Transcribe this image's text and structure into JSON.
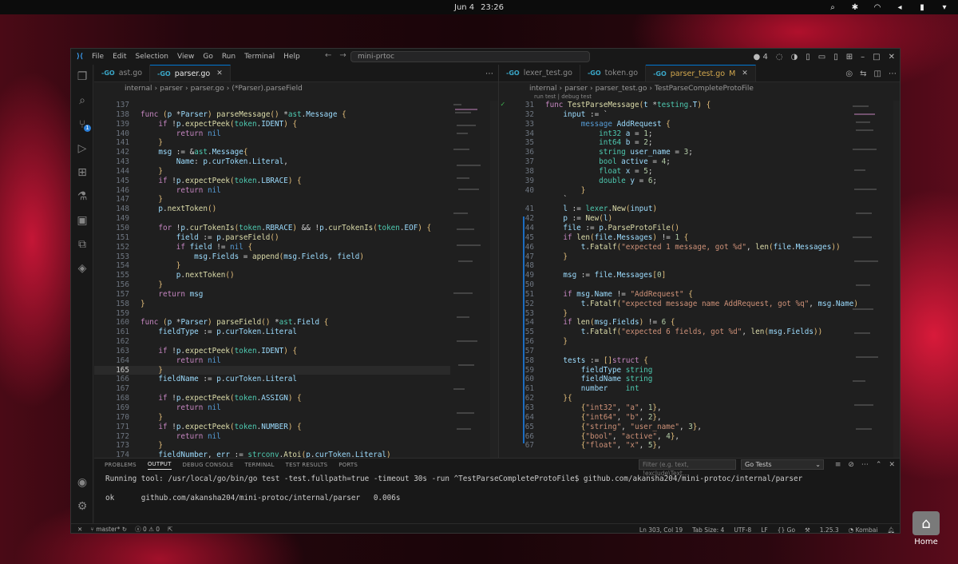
{
  "topbar": {
    "date": "Jun 4",
    "time": "23:26"
  },
  "desktop": {
    "home_label": "Home"
  },
  "menu": [
    "File",
    "Edit",
    "Selection",
    "View",
    "Go",
    "Run",
    "Terminal",
    "Help"
  ],
  "search_text": "mini-prtoc",
  "title_right": {
    "ports": "4"
  },
  "left": {
    "tabs": [
      {
        "label": "ast.go",
        "active": false
      },
      {
        "label": "parser.go",
        "active": true
      }
    ],
    "crumb": [
      "internal",
      "parser",
      "parser.go",
      "(*Parser).parseField"
    ],
    "code": [
      {
        "n": "137",
        "t": ""
      },
      {
        "n": "138",
        "t": "func (p *Parser) parseMessage() *ast.Message {"
      },
      {
        "n": "139",
        "t": "    if !p.expectPeek(token.IDENT) {"
      },
      {
        "n": "140",
        "t": "        return nil"
      },
      {
        "n": "141",
        "t": "    }"
      },
      {
        "n": "142",
        "t": "    msg := &ast.Message{"
      },
      {
        "n": "143",
        "t": "        Name: p.curToken.Literal,"
      },
      {
        "n": "144",
        "t": "    }"
      },
      {
        "n": "145",
        "t": "    if !p.expectPeek(token.LBRACE) {"
      },
      {
        "n": "146",
        "t": "        return nil"
      },
      {
        "n": "147",
        "t": "    }"
      },
      {
        "n": "148",
        "t": "    p.nextToken()"
      },
      {
        "n": "149",
        "t": ""
      },
      {
        "n": "150",
        "t": "    for !p.curTokenIs(token.RBRACE) && !p.curTokenIs(token.EOF) {"
      },
      {
        "n": "151",
        "t": "        field := p.parseField()"
      },
      {
        "n": "152",
        "t": "        if field != nil {"
      },
      {
        "n": "153",
        "t": "            msg.Fields = append(msg.Fields, field)"
      },
      {
        "n": "154",
        "t": "        }"
      },
      {
        "n": "155",
        "t": "        p.nextToken()"
      },
      {
        "n": "156",
        "t": "    }"
      },
      {
        "n": "157",
        "t": "    return msg"
      },
      {
        "n": "158",
        "t": "}"
      },
      {
        "n": "159",
        "t": ""
      },
      {
        "n": "160",
        "t": "func (p *Parser) parseField() *ast.Field {"
      },
      {
        "n": "161",
        "t": "    fieldType := p.curToken.Literal"
      },
      {
        "n": "162",
        "t": ""
      },
      {
        "n": "163",
        "t": "    if !p.expectPeek(token.IDENT) {"
      },
      {
        "n": "164",
        "t": "        return nil"
      },
      {
        "n": "165",
        "t": "    }"
      },
      {
        "n": "166",
        "t": "    fieldName := p.curToken.Literal"
      },
      {
        "n": "167",
        "t": ""
      },
      {
        "n": "168",
        "t": "    if !p.expectPeek(token.ASSIGN) {"
      },
      {
        "n": "169",
        "t": "        return nil"
      },
      {
        "n": "170",
        "t": "    }"
      },
      {
        "n": "171",
        "t": "    if !p.expectPeek(token.NUMBER) {"
      },
      {
        "n": "172",
        "t": "        return nil"
      },
      {
        "n": "173",
        "t": "    }"
      },
      {
        "n": "174",
        "t": "    fieldNumber, err := strconv.Atoi(p.curToken.Literal)"
      }
    ]
  },
  "right": {
    "tabs": [
      {
        "label": "lexer_test.go",
        "active": false
      },
      {
        "label": "token.go",
        "active": false
      },
      {
        "label": "parser_test.go",
        "active": true,
        "status": "M"
      }
    ],
    "crumb": [
      "internal",
      "parser",
      "parser_test.go",
      "TestParseCompleteProtoFile"
    ],
    "codelens": "run test | debug test",
    "code": [
      {
        "n": "31",
        "t": "func TestParseMessage(t *testing.T) {"
      },
      {
        "n": "32",
        "t": "    input := `"
      },
      {
        "n": "33",
        "t": "        message AddRequest {"
      },
      {
        "n": "34",
        "t": "            int32 a = 1;"
      },
      {
        "n": "35",
        "t": "            int64 b = 2;"
      },
      {
        "n": "36",
        "t": "            string user_name = 3;"
      },
      {
        "n": "37",
        "t": "            bool active = 4;"
      },
      {
        "n": "38",
        "t": "            float x = 5;"
      },
      {
        "n": "39",
        "t": "            double y = 6;"
      },
      {
        "n": "40",
        "t": "        }"
      },
      {
        "n": "",
        "t": "    `"
      },
      {
        "n": "41",
        "t": "    l := lexer.New(input)"
      },
      {
        "n": "42",
        "t": "    p := New(l)"
      },
      {
        "n": "44",
        "t": "    file := p.ParseProtoFile()"
      },
      {
        "n": "45",
        "t": "    if len(file.Messages) != 1 {"
      },
      {
        "n": "46",
        "t": "        t.Fatalf(\"expected 1 message, got %d\", len(file.Messages))"
      },
      {
        "n": "47",
        "t": "    }"
      },
      {
        "n": "48",
        "t": ""
      },
      {
        "n": "49",
        "t": "    msg := file.Messages[0]"
      },
      {
        "n": "50",
        "t": ""
      },
      {
        "n": "51",
        "t": "    if msg.Name != \"AddRequest\" {"
      },
      {
        "n": "52",
        "t": "        t.Fatalf(\"expected message name AddRequest, got %q\", msg.Name)"
      },
      {
        "n": "53",
        "t": "    }"
      },
      {
        "n": "54",
        "t": "    if len(msg.Fields) != 6 {"
      },
      {
        "n": "55",
        "t": "        t.Fatalf(\"expected 6 fields, got %d\", len(msg.Fields))"
      },
      {
        "n": "56",
        "t": "    }"
      },
      {
        "n": "57",
        "t": ""
      },
      {
        "n": "58",
        "t": "    tests := []struct {"
      },
      {
        "n": "59",
        "t": "        fieldType string"
      },
      {
        "n": "60",
        "t": "        fieldName string"
      },
      {
        "n": "61",
        "t": "        number    int"
      },
      {
        "n": "62",
        "t": "    }{"
      },
      {
        "n": "63",
        "t": "        {\"int32\", \"a\", 1},"
      },
      {
        "n": "64",
        "t": "        {\"int64\", \"b\", 2},"
      },
      {
        "n": "65",
        "t": "        {\"string\", \"user_name\", 3},"
      },
      {
        "n": "66",
        "t": "        {\"bool\", \"active\", 4},"
      },
      {
        "n": "67",
        "t": "        {\"float\", \"x\", 5},"
      }
    ]
  },
  "panel": {
    "tabs": [
      "PROBLEMS",
      "OUTPUT",
      "DEBUG CONSOLE",
      "TERMINAL",
      "TEST RESULTS",
      "PORTS"
    ],
    "active_tab": "OUTPUT",
    "filter_placeholder": "Filter (e.g. text, !exclude\\Text...",
    "channel": "Go Tests",
    "output": [
      "Running tool: /usr/local/go/bin/go test -test.fullpath=true -timeout 30s -run ^TestParseCompleteProtoFile$ github.com/akansha204/mini-protoc/internal/parser",
      "",
      "ok      github.com/akansha204/mini-protoc/internal/parser   0.006s"
    ]
  },
  "status": {
    "branch": "master*",
    "errors": "0",
    "warnings": "0",
    "position": "Ln 303, Col 19",
    "tab_size": "Tab Size: 4",
    "encoding": "UTF-8",
    "eol": "LF",
    "language": "Go",
    "go_version": "1.25.3",
    "theme": "Kombai"
  },
  "colors": {
    "accent": "#0078d4",
    "keyword": "#c586c0",
    "function": "#dcdcaa",
    "type": "#4ec9b0",
    "string": "#ce9178",
    "number": "#b5cea8"
  }
}
